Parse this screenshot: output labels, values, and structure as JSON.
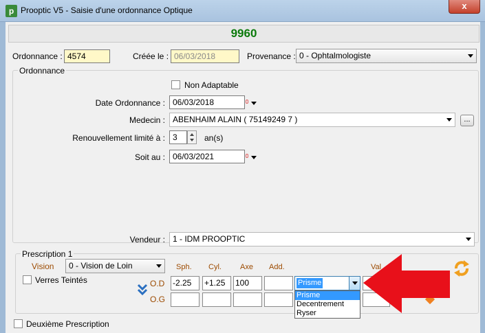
{
  "window": {
    "title": "Prooptic V5 - Saisie d'une ordonnance Optique",
    "close_glyph": "x",
    "app_icon_letter": "p"
  },
  "header": {
    "number": "9960"
  },
  "top": {
    "ordonnance_label": "Ordonnance :",
    "ordonnance_value": "4574",
    "creee_label": "Créée le :",
    "creee_value": "06/03/2018",
    "provenance_label": "Provenance :",
    "provenance_value": "0 - Ophtalmologiste"
  },
  "ordonnance_group": {
    "title": "Ordonnance",
    "non_adaptable_label": "Non Adaptable",
    "date_label": "Date Ordonnance :",
    "date_value": "06/03/2018",
    "medecin_label": "Medecin :",
    "medecin_value": "ABENHAIM ALAIN  ( 75149249 7 )",
    "medecin_btn": "...",
    "renouv_label": "Renouvellement limité à :",
    "renouv_value": "3",
    "renouv_unit": "an(s)",
    "soit_label": "Soit au :",
    "soit_value": "06/03/2021"
  },
  "vendeur": {
    "label": "Vendeur :",
    "value": "1 - IDM PROOPTIC"
  },
  "prescription": {
    "title": "Prescription 1",
    "vision_label": "Vision",
    "vision_value": "0 - Vision de Loin",
    "verres_label": "Verres Teintés",
    "columns": {
      "sph": "Sph.",
      "cyl": "Cyl.",
      "axe": "Axe",
      "add": "Add.",
      "val": "Val"
    },
    "od_label": "O.D",
    "og_label": "O.G",
    "od": {
      "sph": "-2.25",
      "cyl": "+1.25",
      "axe": "100",
      "add": ""
    },
    "og": {
      "sph": "",
      "cyl": "",
      "axe": "",
      "add": ""
    },
    "prisme_value": "Prisme",
    "prisme_options": [
      "Prisme",
      "Decentrement",
      "Ryser"
    ]
  },
  "deuxieme": {
    "label": "Deuxième Prescription"
  },
  "colors": {
    "number_green": "#0b7a0b",
    "accent_red": "#e8101a",
    "column_brown": "#9c4a00",
    "sync_orange": "#f0a020"
  }
}
